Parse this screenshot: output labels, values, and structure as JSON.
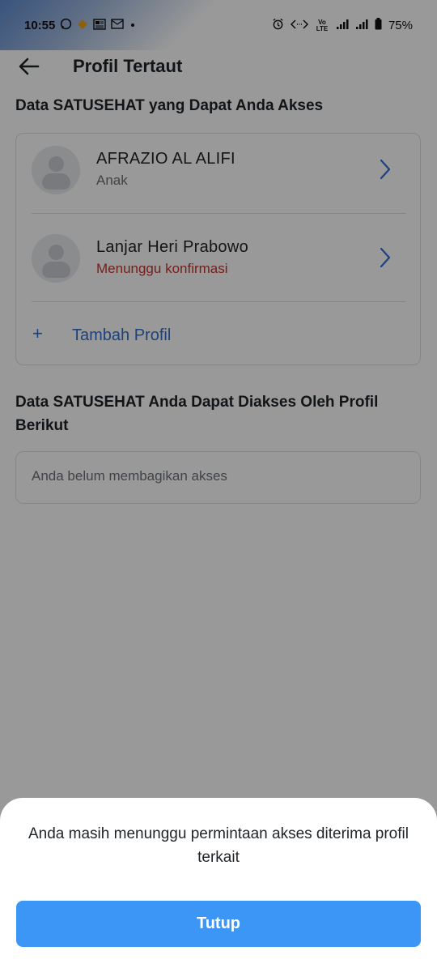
{
  "status_bar": {
    "time": "10:55",
    "battery": "75%",
    "left_icons": [
      "whatsapp-icon",
      "app-icon",
      "news-icon",
      "mail-icon",
      "dot-icon"
    ],
    "right_icons": [
      "alarm-icon",
      "data-transfer-icon",
      "volte-icon",
      "signal-icon",
      "signal-icon",
      "battery-icon"
    ],
    "volte_label": "Vo LTE"
  },
  "header": {
    "title": "Profil Tertaut",
    "back_icon": "arrow-left-icon"
  },
  "accessible_section": {
    "title": "Data SATUSEHAT yang Dapat Anda Akses",
    "profiles": [
      {
        "name": "AFRAZIO AL ALIFI",
        "subtitle": "Anak",
        "status": "normal"
      },
      {
        "name": "Lanjar Heri Prabowo",
        "subtitle": "Menunggu konfirmasi",
        "status": "pending"
      }
    ],
    "add_label": "Tambah Profil",
    "add_icon": "plus-icon"
  },
  "shared_section": {
    "title": "Data SATUSEHAT Anda Dapat Diakses Oleh Profil Berikut",
    "empty_text": "Anda belum membagikan akses"
  },
  "bottom_sheet": {
    "message": "Anda masih menunggu permintaan akses diterima profil terkait",
    "close_label": "Tutup"
  },
  "colors": {
    "primary": "#3c96f5",
    "link": "#2f6fd0",
    "pending": "#c4342c",
    "overlay": "rgba(0,0,0,0.40)"
  }
}
